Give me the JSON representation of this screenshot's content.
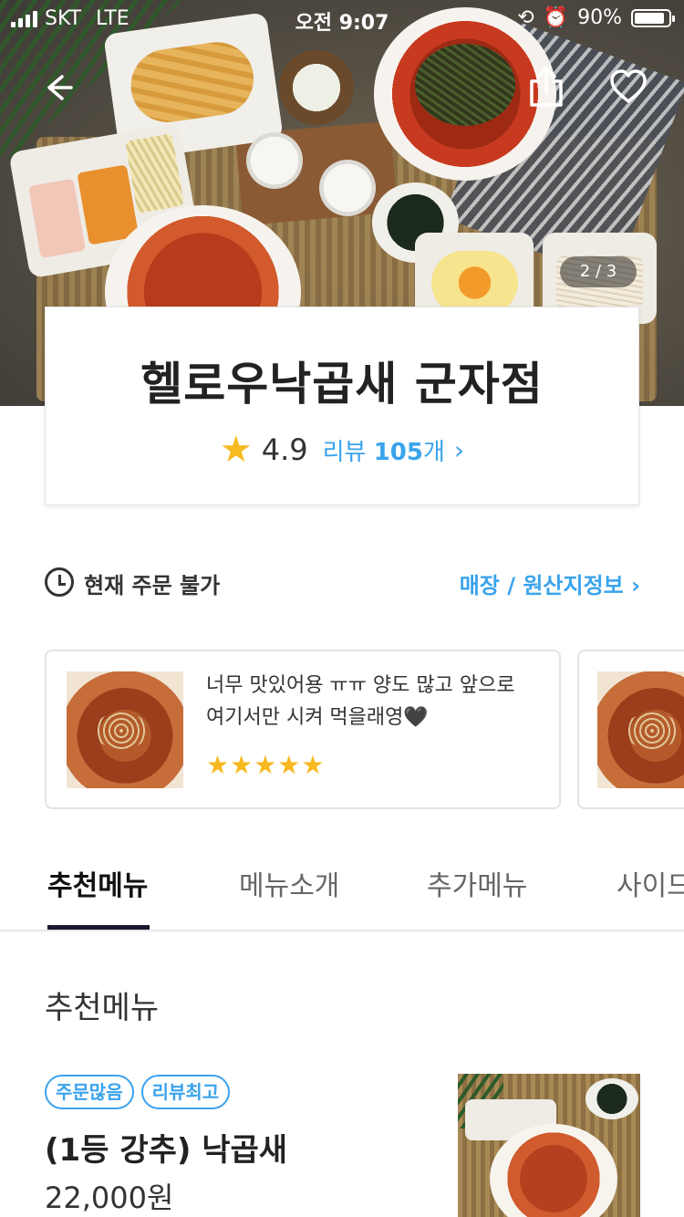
{
  "status_bar": {
    "carrier": "SKT",
    "network": "LTE",
    "time": "오전 9:07",
    "battery": "90%",
    "battery_level": 0.9
  },
  "hero": {
    "back_icon": "back-arrow-icon",
    "share_icon": "share-icon",
    "favorite_icon": "heart-icon",
    "image_counter": "2 / 3"
  },
  "store": {
    "name": "헬로우낙곱새 군자점",
    "rating": "4.9",
    "review_prefix": "리뷰",
    "review_count": "105",
    "review_suffix": "개"
  },
  "order_status": {
    "text": "현재 주문 불가",
    "store_info_link": "매장 / 원산지정보"
  },
  "reviews": [
    {
      "text": "너무 맛있어용 ㅠㅠ 양도 많고 앞으로 여기서만 시켜 먹을래영🖤",
      "stars": "★★★★★",
      "rating": 5
    }
  ],
  "tabs": [
    {
      "label": "추천메뉴",
      "active": true
    },
    {
      "label": "메뉴소개",
      "active": false
    },
    {
      "label": "추가메뉴",
      "active": false
    },
    {
      "label": "사이드",
      "active": false
    }
  ],
  "menu_section": {
    "title": "추천메뉴",
    "items": [
      {
        "badges": [
          "주문많음",
          "리뷰최고"
        ],
        "name": "(1등 강추) 낙곱새",
        "price": "22,000원"
      }
    ]
  },
  "colors": {
    "accent": "#3aa3ec",
    "star": "#f7b91f",
    "tab_indicator": "#1a1a2e"
  }
}
